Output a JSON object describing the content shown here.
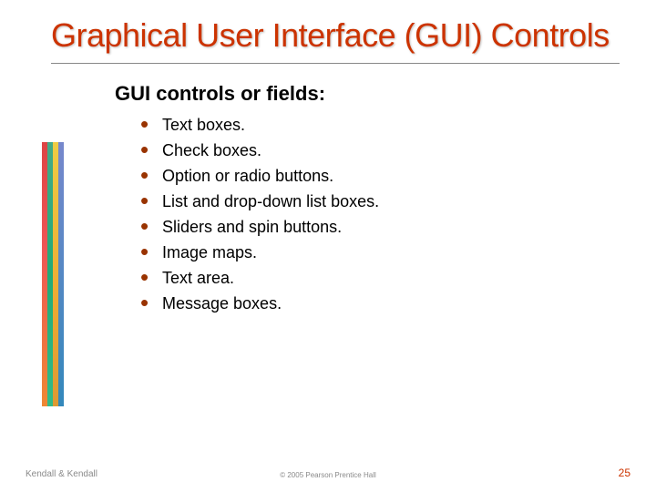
{
  "title": "Graphical User Interface (GUI) Controls",
  "subhead": "GUI controls or fields:",
  "bullets": [
    "Text boxes.",
    "Check boxes.",
    "Option or radio buttons.",
    "List and drop-down list boxes.",
    "Sliders and spin buttons.",
    "Image maps.",
    "Text area.",
    "Message boxes."
  ],
  "footer": {
    "left": "Kendall & Kendall",
    "center": "© 2005 Pearson Prentice Hall",
    "page": "25"
  }
}
